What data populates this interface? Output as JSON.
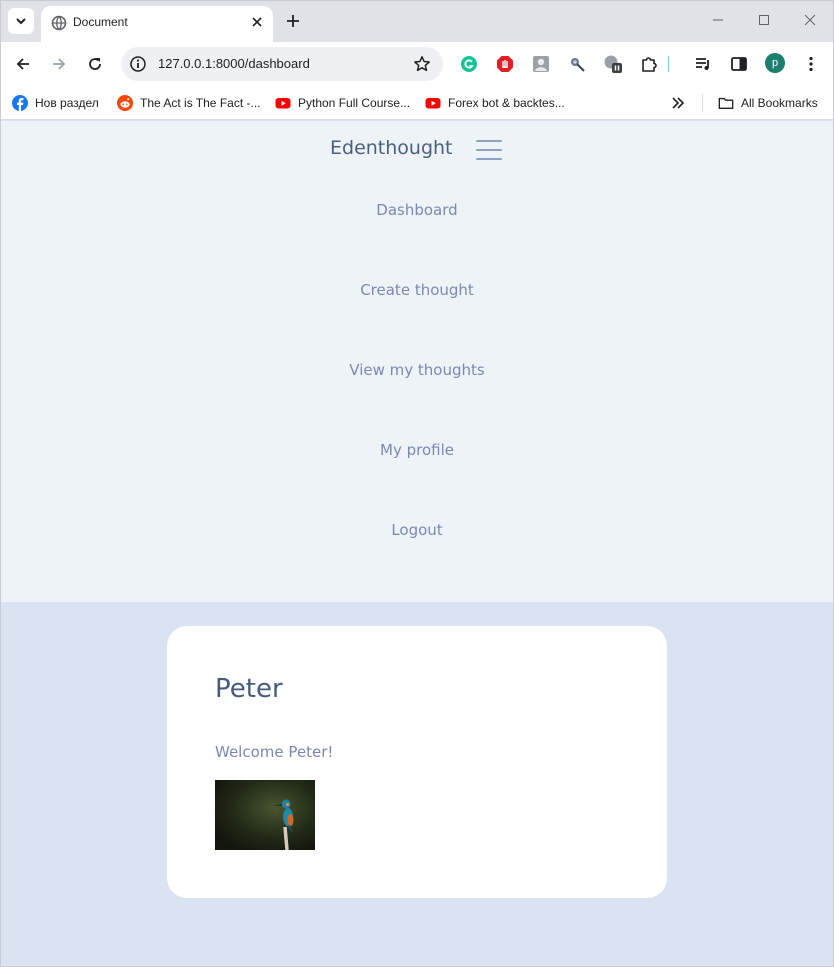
{
  "browser": {
    "tab_title": "Document",
    "url": "127.0.0.1:8000/dashboard",
    "profile_initial": "p",
    "bookmarks": [
      {
        "label": "Нов раздел",
        "icon": "facebook-icon"
      },
      {
        "label": "The Act is The Fact -...",
        "icon": "reddit-icon"
      },
      {
        "label": "Python Full Course...",
        "icon": "youtube-icon"
      },
      {
        "label": "Forex bot & backtes...",
        "icon": "youtube-icon"
      }
    ],
    "all_bookmarks_label": "All Bookmarks",
    "colors": {
      "reddit": "#ff4500",
      "youtube": "#ff0000",
      "facebook": "#1877f2",
      "grammarly": "#15c39a"
    }
  },
  "app": {
    "brand": "Edenthought",
    "nav": [
      {
        "label": "Dashboard"
      },
      {
        "label": "Create thought"
      },
      {
        "label": "View my thoughts"
      },
      {
        "label": "My profile"
      },
      {
        "label": "Logout"
      }
    ]
  },
  "dashboard": {
    "username": "Peter",
    "welcome": "Welcome Peter!",
    "photo_icon": "kingfisher-photo"
  }
}
